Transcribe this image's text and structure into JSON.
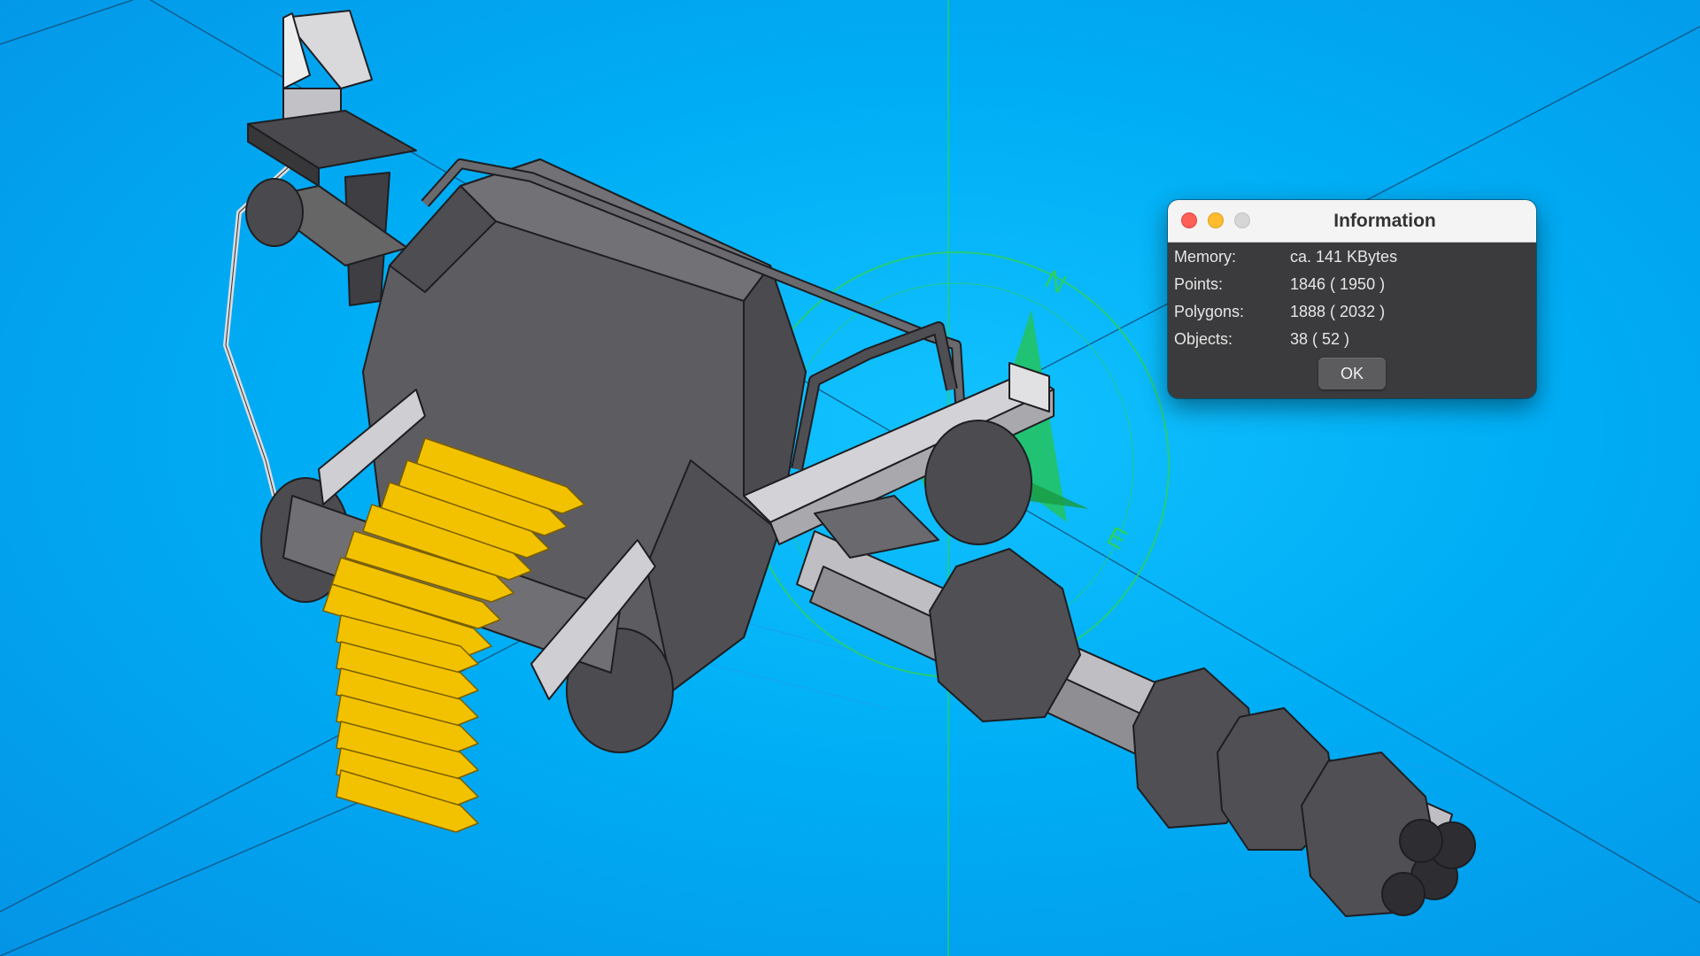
{
  "viewport": {
    "compass_labels": [
      "N",
      "E"
    ],
    "colors": {
      "background": "#00aef5",
      "model_gray": "#5a5a5e",
      "model_light": "#c8c8cc",
      "bullets": "#f2c200",
      "compass": "#25c35a",
      "grid_lines": "#1a4e7a"
    },
    "model_icon": "minigun-model-icon"
  },
  "dialog": {
    "title": "Information",
    "rows": [
      {
        "label": "Memory:",
        "value": "ca. 141 KBytes"
      },
      {
        "label": "Points:",
        "value": "1846 ( 1950 )"
      },
      {
        "label": "Polygons:",
        "value": "1888 ( 2032 )"
      },
      {
        "label": "Objects:",
        "value": "38 ( 52 )"
      }
    ],
    "ok_label": "OK"
  }
}
